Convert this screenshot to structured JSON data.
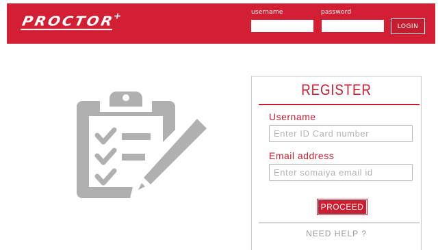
{
  "header": {
    "logo_text": "PROCTOR",
    "logo_mark": "+",
    "username_label": "username",
    "password_label": "password",
    "username_value": "",
    "password_value": "",
    "login_label": "LOGIN",
    "brand_color": "#d31f33"
  },
  "illustration": {
    "icon": "clipboard-checklist-pencil-icon",
    "color": "#b0b0b0"
  },
  "register": {
    "title": "REGISTER",
    "username_label": "Username",
    "username_placeholder": "Enter ID Card number",
    "email_label": "Email address",
    "email_placeholder": "Enter somaiya email id",
    "proceed_label": "PROCEED",
    "help_label": "NEED HELP ?",
    "accent_color": "#c41d30"
  }
}
